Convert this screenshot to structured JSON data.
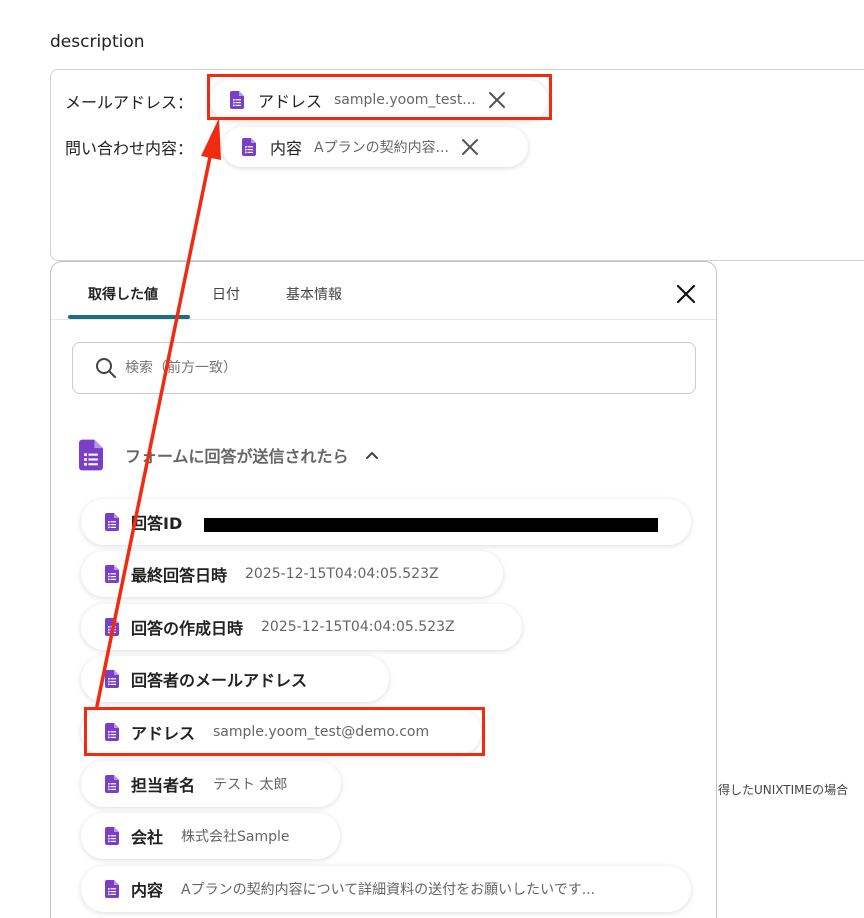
{
  "field": {
    "label": "description"
  },
  "description": {
    "lines": [
      {
        "label": "メールアドレス：",
        "chip_name": "アドレス",
        "chip_value": "sample.yoom_test..."
      },
      {
        "label": "問い合わせ内容：",
        "chip_name": "内容",
        "chip_value": "Aプランの契約内容..."
      }
    ]
  },
  "popover": {
    "tabs": [
      {
        "label": "取得した値",
        "active": true
      },
      {
        "label": "日付",
        "active": false
      },
      {
        "label": "基本情報",
        "active": false
      }
    ],
    "search": {
      "placeholder": "検索（前方一致）",
      "value": ""
    },
    "group": {
      "title": "フォームに回答が送信されたら"
    },
    "items": [
      {
        "name": "回答ID",
        "value": ""
      },
      {
        "name": "最終回答日時",
        "value": "2025-12-15T04:04:05.523Z"
      },
      {
        "name": "回答の作成日時",
        "value": "2025-12-15T04:04:05.523Z"
      },
      {
        "name": "回答者のメールアドレス",
        "value": ""
      },
      {
        "name": "アドレス",
        "value": "sample.yoom_test@demo.com"
      },
      {
        "name": "担当者名",
        "value": "テスト 太郎"
      },
      {
        "name": "会社",
        "value": "株式会社Sample"
      },
      {
        "name": "内容",
        "value": "Aプランの契約内容について詳細資料の送付をお願いしたいです..."
      }
    ]
  },
  "side_note": "得したUNIXTIMEの場合",
  "colors": {
    "accent": "#1d6e80",
    "highlight": "#f02b10",
    "doc_icon": "#7a3fc6"
  },
  "icons": [
    "google-forms-doc-icon",
    "close-icon",
    "search-icon",
    "chevron-up-icon"
  ]
}
